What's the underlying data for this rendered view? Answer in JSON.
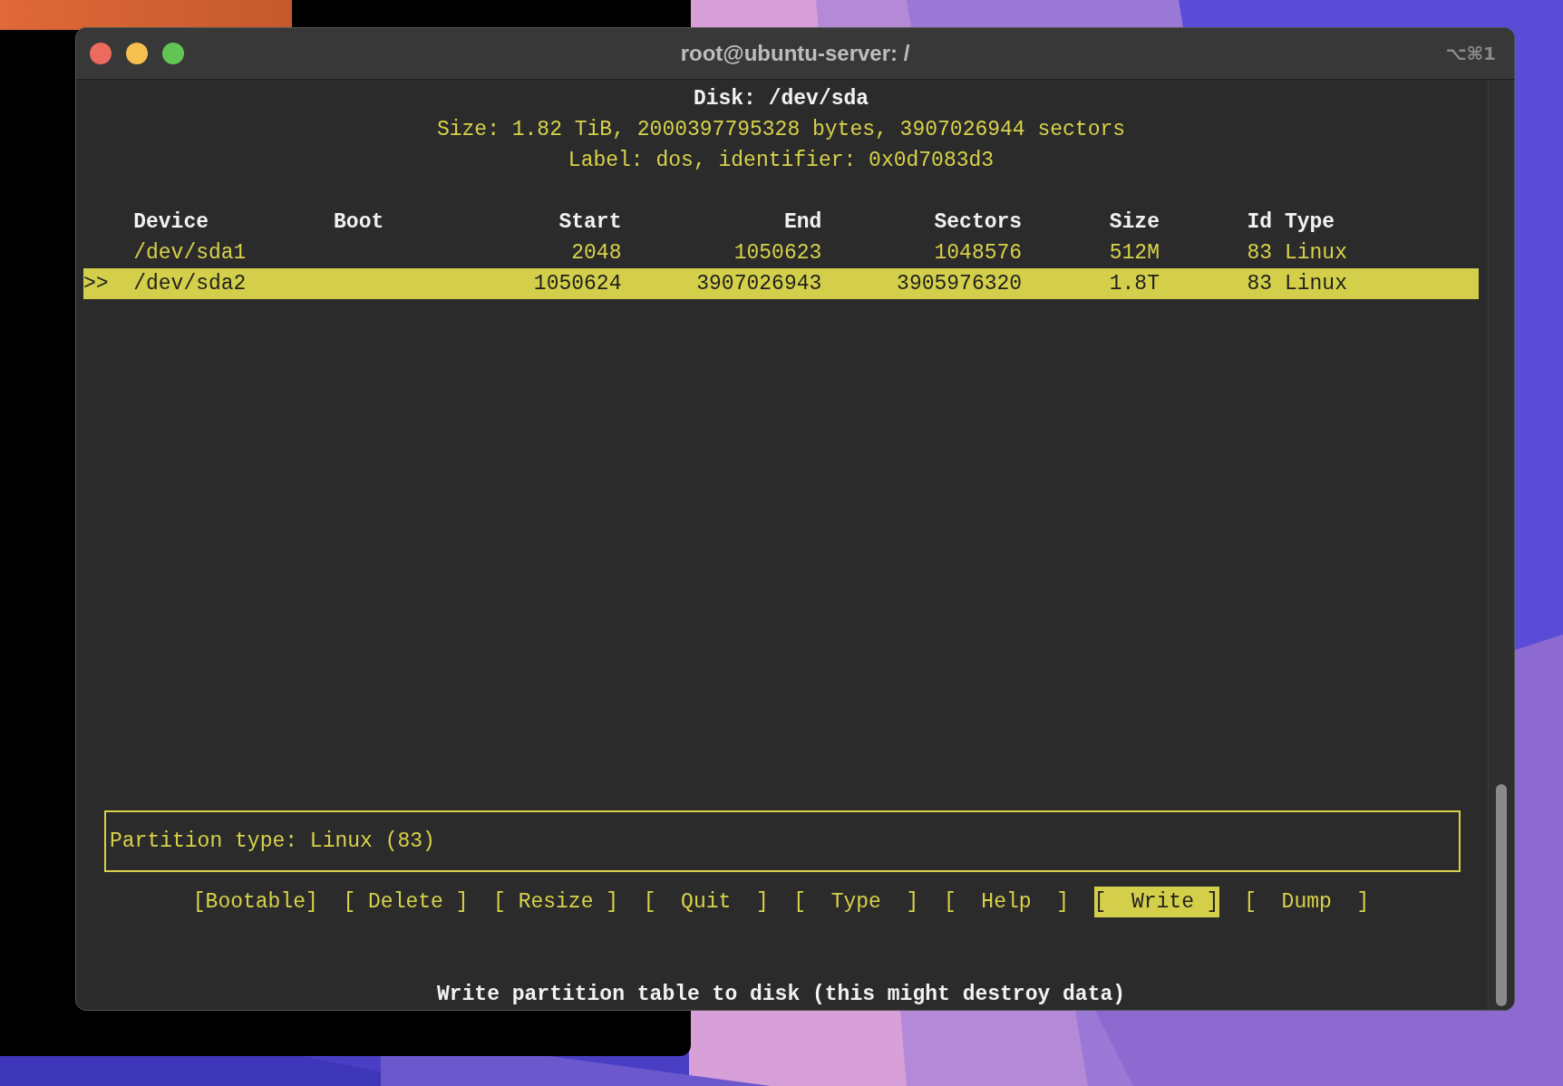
{
  "window": {
    "title": "root@ubuntu-server: /",
    "shortcut": "⌥⌘1"
  },
  "disk": {
    "title": "Disk: /dev/sda",
    "size": "Size: 1.82 TiB, 2000397795328 bytes, 3907026944 sectors",
    "label": "Label: dos, identifier: 0x0d7083d3"
  },
  "table": {
    "columns": [
      "Device",
      "Boot",
      "Start",
      "End",
      "Sectors",
      "Size",
      "Id",
      "Type"
    ],
    "rows": [
      {
        "selected": false,
        "marker": "",
        "cells": [
          "/dev/sda1",
          "",
          "2048",
          "1050623",
          "1048576",
          "512M",
          "83",
          "Linux"
        ]
      },
      {
        "selected": true,
        "marker": ">>",
        "cells": [
          "/dev/sda2",
          "",
          "1050624",
          "3907026943",
          "3905976320",
          "1.8T",
          "83",
          "Linux"
        ]
      }
    ]
  },
  "info_box": "Partition type: Linux (83)",
  "buttons": [
    {
      "label": "[Bootable]",
      "selected": false
    },
    {
      "label": "[ Delete ]",
      "selected": false
    },
    {
      "label": "[ Resize ]",
      "selected": false
    },
    {
      "label": "[  Quit  ]",
      "selected": false
    },
    {
      "label": "[  Type  ]",
      "selected": false
    },
    {
      "label": "[  Help  ]",
      "selected": false
    },
    {
      "label": "[  Write ]",
      "selected": true
    },
    {
      "label": "[  Dump  ]",
      "selected": false
    }
  ],
  "status": "Write partition table to disk (this might destroy data)"
}
